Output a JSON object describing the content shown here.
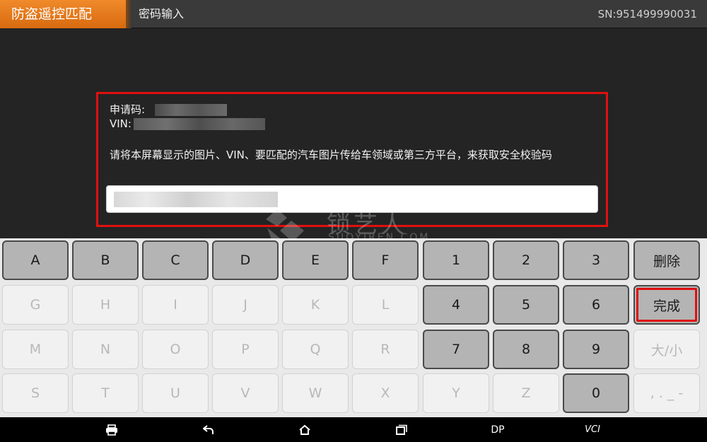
{
  "header": {
    "app_title": "防盗遥控匹配",
    "breadcrumb": "密码输入",
    "serial": "SN:951499990031"
  },
  "dialog": {
    "request_code_label": "申请码:",
    "vin_label": "VIN:",
    "instruction": "请将本屏幕显示的图片、VIN、要匹配的汽车图片传给车领域或第三方平台，来获取安全校验码",
    "input_value": "",
    "border_color": "#e01010"
  },
  "watermark": {
    "cn": "锁艺人",
    "en": "SUOYIREN.COM"
  },
  "keyboard": {
    "rows": [
      [
        {
          "label": "A",
          "enabled": true
        },
        {
          "label": "B",
          "enabled": true
        },
        {
          "label": "C",
          "enabled": true
        },
        {
          "label": "D",
          "enabled": true
        },
        {
          "label": "E",
          "enabled": true
        },
        {
          "label": "F",
          "enabled": true
        },
        {
          "label": "1",
          "enabled": true
        },
        {
          "label": "2",
          "enabled": true
        },
        {
          "label": "3",
          "enabled": true
        },
        {
          "label": "删除",
          "enabled": true
        }
      ],
      [
        {
          "label": "G",
          "enabled": false
        },
        {
          "label": "H",
          "enabled": false
        },
        {
          "label": "I",
          "enabled": false
        },
        {
          "label": "J",
          "enabled": false
        },
        {
          "label": "K",
          "enabled": false
        },
        {
          "label": "L",
          "enabled": false
        },
        {
          "label": "4",
          "enabled": true
        },
        {
          "label": "5",
          "enabled": true
        },
        {
          "label": "6",
          "enabled": true
        },
        {
          "label": "完成",
          "enabled": true,
          "highlighted": true
        }
      ],
      [
        {
          "label": "M",
          "enabled": false
        },
        {
          "label": "N",
          "enabled": false
        },
        {
          "label": "O",
          "enabled": false
        },
        {
          "label": "P",
          "enabled": false
        },
        {
          "label": "Q",
          "enabled": false
        },
        {
          "label": "R",
          "enabled": false
        },
        {
          "label": "7",
          "enabled": true
        },
        {
          "label": "8",
          "enabled": true
        },
        {
          "label": "9",
          "enabled": true
        },
        {
          "label": "大/小",
          "enabled": false
        }
      ],
      [
        {
          "label": "S",
          "enabled": false
        },
        {
          "label": "T",
          "enabled": false
        },
        {
          "label": "U",
          "enabled": false
        },
        {
          "label": "V",
          "enabled": false
        },
        {
          "label": "W",
          "enabled": false
        },
        {
          "label": "X",
          "enabled": false
        },
        {
          "label": "Y",
          "enabled": false
        },
        {
          "label": "Z",
          "enabled": false
        },
        {
          "label": "0",
          "enabled": true
        },
        {
          "label": ", . _ -",
          "enabled": false
        }
      ]
    ]
  },
  "navbar": {
    "items": [
      {
        "icon": "printer-icon",
        "label": ""
      },
      {
        "icon": "back-icon",
        "label": ""
      },
      {
        "icon": "home-icon",
        "label": ""
      },
      {
        "icon": "recent-apps-icon",
        "label": ""
      },
      {
        "icon": "",
        "label": "DP"
      },
      {
        "icon": "",
        "label": "VCI"
      }
    ]
  }
}
